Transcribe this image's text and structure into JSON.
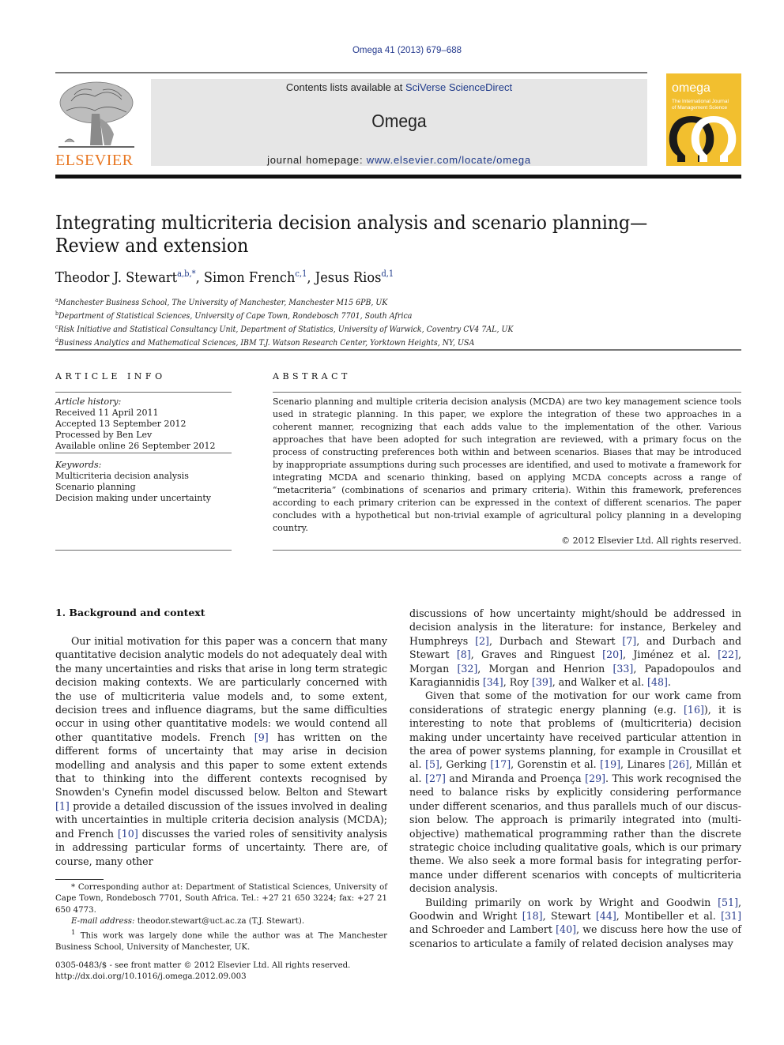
{
  "header": {
    "journal_ref": "Omega 41 (2013) 679–688",
    "contents_prefix": "Contents lists available at ",
    "contents_link": "SciVerse ScienceDirect",
    "journal_name": "Omega",
    "homepage_prefix": "journal homepage: ",
    "homepage_link": "www.elsevier.com/locate/omega",
    "publisher_logo_text": "ELSEVIER",
    "cover": {
      "title": "omega",
      "subtitle_line1": "The International Journal",
      "subtitle_line2": "of Management Science",
      "color": "#f2bf2f"
    }
  },
  "article": {
    "title": "Integrating multicriteria decision analysis and scenario planning—Review and extension",
    "authors": [
      {
        "name": "Theodor J. Stewart",
        "marks": "a,b,*"
      },
      {
        "name": "Simon French",
        "marks": "c,1"
      },
      {
        "name": "Jesus Rios",
        "marks": "d,1"
      }
    ],
    "affiliations": [
      {
        "mark": "a",
        "text": "Manchester Business School, The University of Manchester, Manchester M15 6PB, UK"
      },
      {
        "mark": "b",
        "text": "Department of Statistical Sciences, University of Cape Town, Rondebosch 7701, South Africa"
      },
      {
        "mark": "c",
        "text": "Risk Initiative and Statistical Consultancy Unit, Department of Statistics, University of Warwick, Coventry CV4 7AL, UK"
      },
      {
        "mark": "d",
        "text": "Business Analytics and Mathematical Sciences, IBM T.J. Watson Research Center, Yorktown Heights, NY, USA"
      }
    ]
  },
  "article_info": {
    "heading": "ARTICLE INFO",
    "history_label": "Article history:",
    "history": [
      "Received 11 April 2011",
      "Accepted 13 September 2012",
      "Processed by Ben Lev",
      "Available online 26 September 2012"
    ],
    "keywords_label": "Keywords:",
    "keywords": [
      "Multicriteria decision analysis",
      "Scenario planning",
      "Decision making under uncertainty"
    ]
  },
  "abstract": {
    "heading": "ABSTRACT",
    "text": "Scenario planning and multiple criteria decision analysis (MCDA) are two key management science tools used in strategic planning. In this paper, we explore the integration of these two approaches in a coherent manner, recognizing that each adds value to the implementation of the other. Various approaches that have been adopted for such integration are reviewed, with a primary focus on the process of constructing preferences both within and between scenarios. Biases that may be introduced by inappropriate assumptions during such processes are identified, and used to motivate a framework for integrating MCDA and scenario thinking, based on applying MCDA concepts across a range of “metacriteria” (combinations of scenarios and primary criteria). Within this framework, preferences according to each primary criterion can be expressed in the context of different scenarios. The paper concludes with a hypothetical but non-trivial example of agricultural policy planning in a developing country.",
    "copyright": "© 2012 Elsevier Ltd. All rights reserved."
  },
  "body": {
    "section_heading": "1.  Background and context",
    "left_para": [
      {
        "t": "Our initial motivation for this paper was a concern that many quantitative decision analytic models do not adequately deal with the many uncertainties and risks that arise in long term strategic decision making contexts. We are particularly concerned with the use of multicriteria value models and, to some extent, decision trees and influence diagrams, but the same difficulties occur in using other quantitative models: we would contend all other quantitative models. French "
      },
      {
        "c": "[9]"
      },
      {
        "t": " has written on the different forms of uncertainty that may arise in decision modelling and analysis and this paper to some extent extends that to thinking into the different contexts recognised by Snowden's Cynefin model dis­cussed below. Belton and Stewart "
      },
      {
        "c": "[1]"
      },
      {
        "t": " provide a detailed discus­sion of the issues involved in dealing with uncertainties in multiple criteria decision analysis (MCDA); and French "
      },
      {
        "c": "[10]"
      },
      {
        "t": " discusses the varied roles of sensitivity analysis in addressing particular forms of uncertainty. There are, of course, many other"
      }
    ],
    "right_para_1": [
      {
        "t": "discussions of how uncertainty might/should be addressed in decision analysis in the literature: for instance, Berkeley and Humphreys "
      },
      {
        "c": "[2]"
      },
      {
        "t": ", Durbach and Stewart "
      },
      {
        "c": "[7]"
      },
      {
        "t": ", and Durbach and Stewart "
      },
      {
        "c": "[8]"
      },
      {
        "t": ", Graves and Ringuest "
      },
      {
        "c": "[20]"
      },
      {
        "t": ", Jiménez et al. "
      },
      {
        "c": "[22]"
      },
      {
        "t": ", Morgan "
      },
      {
        "c": "[32]"
      },
      {
        "t": ", Morgan and Henrion "
      },
      {
        "c": "[33]"
      },
      {
        "t": ", Papadopoulos and Karagiannidis "
      },
      {
        "c": "[34]"
      },
      {
        "t": ", Roy "
      },
      {
        "c": "[39]"
      },
      {
        "t": ", and Walker et al. "
      },
      {
        "c": "[48]"
      },
      {
        "t": "."
      }
    ],
    "right_para_2": [
      {
        "t": "Given that some of the motivation for our work came from considerations of strategic energy planning (e.g. "
      },
      {
        "c": "[16]"
      },
      {
        "t": "), it is interesting to note that problems of (multicriteria) decision making under uncertainty have received particular attention in the area of power systems planning, for example in Crousillat et al. "
      },
      {
        "c": "[5]"
      },
      {
        "t": ", Gerking "
      },
      {
        "c": "[17]"
      },
      {
        "t": ", Gorenstin et al. "
      },
      {
        "c": "[19]"
      },
      {
        "t": ", Linares "
      },
      {
        "c": "[26]"
      },
      {
        "t": ", Millán et al. "
      },
      {
        "c": "[27]"
      },
      {
        "t": " and Miranda and Proença "
      },
      {
        "c": "[29]"
      },
      {
        "t": ". This work recognised the need to balance risks by explicitly considering performance under different scenarios, and thus parallels much of our discus­sion below. The approach is primarily integrated into (multi-objective) mathematical programming rather than the discrete strategic choice including qualitative goals, which is our primary theme. We also seek a more formal basis for integrating perfor­mance under different scenarios with concepts of multicriteria decision analysis."
      }
    ],
    "right_para_3": [
      {
        "t": "Building primarily on work by Wright and Goodwin "
      },
      {
        "c": "[51]"
      },
      {
        "t": ", Goodwin and Wright "
      },
      {
        "c": "[18]"
      },
      {
        "t": ", Stewart "
      },
      {
        "c": "[44]"
      },
      {
        "t": ", Montibeller et al. "
      },
      {
        "c": "[31]"
      },
      {
        "t": " and Schroeder and Lambert "
      },
      {
        "c": "[40]"
      },
      {
        "t": ", we discuss here how the use of scenarios to articulate a family of related decision analyses may"
      }
    ]
  },
  "footnotes": {
    "corresponding": "* Corresponding author at: Department of Statistical Sciences, University of Cape Town, Rondebosch 7701, South Africa. Tel.: +27 21 650 3224; fax: +27 21 650 4773.",
    "email_label": "E-mail address:",
    "email_value": " theodor.stewart@uct.ac.za (T.J. Stewart).",
    "note1_mark": "1",
    "note1": " This work was largely done while the author was at The Manchester Business School, University of Manchester, UK."
  },
  "front_matter": {
    "issn_line": "0305-0483/$ - see front matter © 2012 Elsevier Ltd. All rights reserved.",
    "doi": "http://dx.doi.org/10.1016/j.omega.2012.09.003"
  },
  "colors": {
    "link": "#1f3a8a",
    "elsevier_orange": "#e87722",
    "banner_gray": "#e6e6e6"
  }
}
